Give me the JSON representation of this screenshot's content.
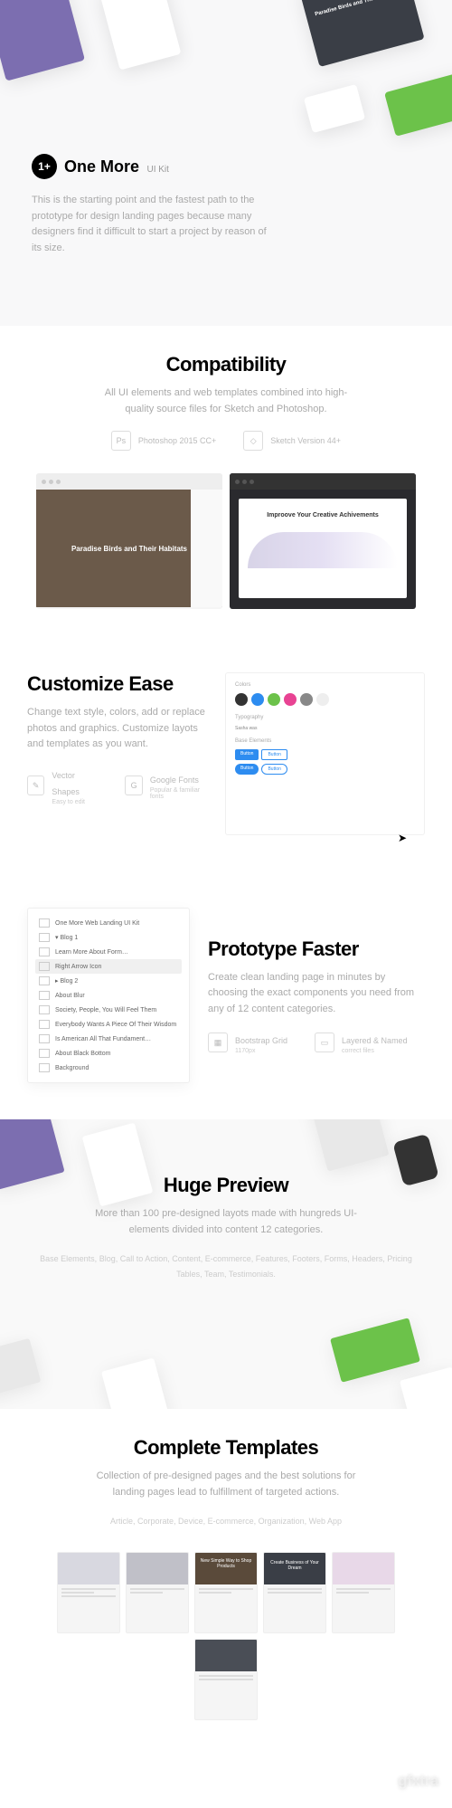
{
  "hero": {
    "logo_badge": "1+",
    "logo_name": "One More",
    "logo_suffix": "UI Kit",
    "description": "This is the starting point and the fastest path to the prototype for design landing pages because many designers find it difficult to start a project by reason of its size.",
    "card_title": "Paradise Birds and Their Habitats"
  },
  "compatibility": {
    "heading": "Compatibility",
    "subtext": "All UI elements and web templates combined into high-quality source files for Sketch and Photoshop.",
    "features": [
      {
        "icon": "Ps",
        "label": "Photoshop 2015 CC+"
      },
      {
        "icon": "◇",
        "label": "Sketch Version 44+"
      }
    ],
    "screen_left_title": "Paradise Birds and Their Habitats",
    "screen_right_title": "Improove Your Creative Achivements"
  },
  "customize": {
    "heading": "Customize Ease",
    "subtext": "Change text style, colors, add or replace photos and graphics. Customize layots and templates as you want.",
    "features": [
      {
        "icon": "✎",
        "label": "Vector Shapes",
        "sublabel": "Easy to edit"
      },
      {
        "icon": "G",
        "label": "Google Fonts",
        "sublabel": "Popular & familiar fonts"
      }
    ],
    "panel": {
      "colors_title": "Colors",
      "typography_title": "Typography",
      "typography_sample": "Sasha was",
      "elements_title": "Base Elements",
      "swatches": [
        "#333333",
        "#2d8cf0",
        "#6cc24a",
        "#e84393",
        "#888888",
        "#eeeeee"
      ]
    }
  },
  "prototype": {
    "heading": "Prototype Faster",
    "subtext": "Create clean landing page in minutes by choosing the exact components you need from any of 12 content categories.",
    "features": [
      {
        "icon": "▦",
        "label": "Bootstrap Grid",
        "sublabel": "1170px"
      },
      {
        "icon": "▭",
        "label": "Layered & Named",
        "sublabel": "correct files"
      }
    ],
    "layers": [
      "One More Web Landing UI Kit",
      "▾ Blog 1",
      "Learn More About Form…",
      "Right Arrow Icon",
      "▸ Blog 2",
      "About Blur",
      "Society, People, You Will Feel Them",
      "Everybody Wants A Piece Of Their Wisdom",
      "Is American All That Fundament…",
      "About Black Bottom",
      "Background"
    ]
  },
  "preview": {
    "heading": "Huge Preview",
    "subtext": "More than 100 pre-designed layots made with hungreds UI-elements divided into content 12 categories.",
    "categories": "Base Elements, Blog, Call to Action, Content, E-commerce, Features, Footers, Forms, Headers, Pricing Tables, Team, Testimonials."
  },
  "templates": {
    "heading": "Complete Templates",
    "subtext": "Collection of pre-designed pages and the best solutions for landing pages lead to fulfillment of targeted actions.",
    "categories": "Article, Corporate, Device, E-commerce, Organization, Web App",
    "template_titles": {
      "t3": "Create Business of Your Dream",
      "t5": "New Simple Way to Shop Products"
    }
  },
  "watermark": "gfxtra"
}
